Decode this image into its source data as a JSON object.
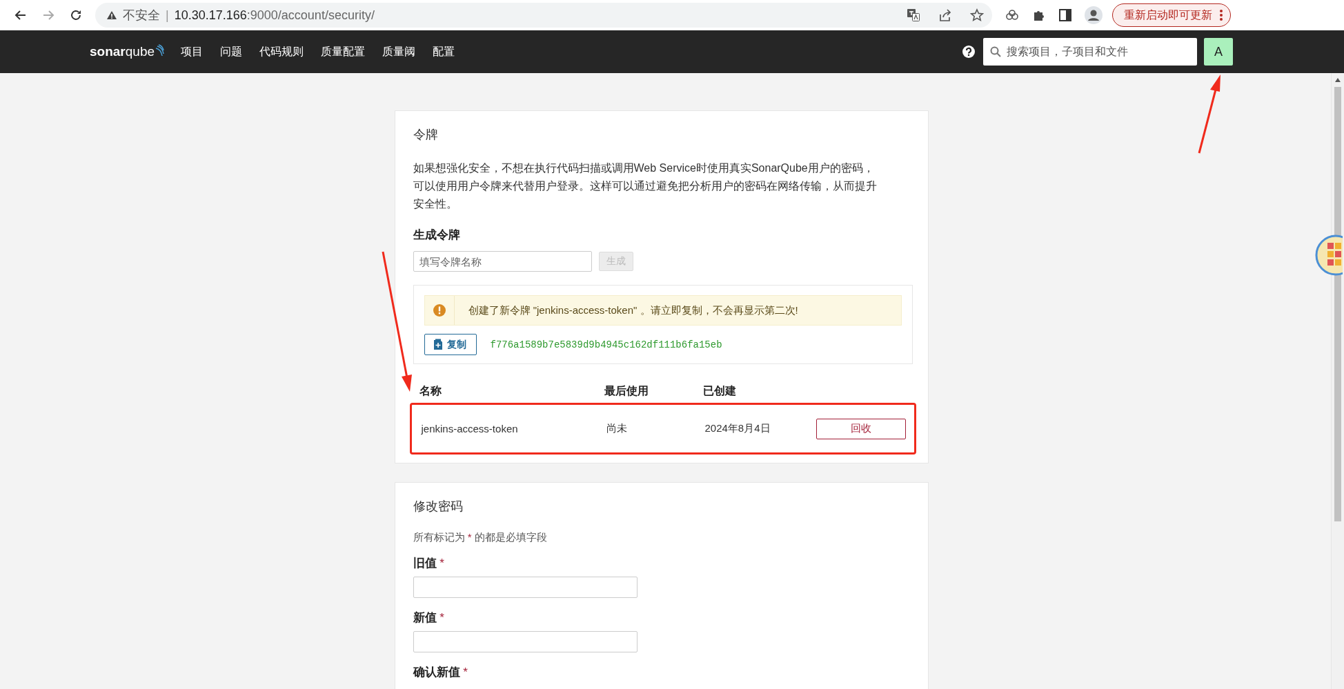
{
  "browser": {
    "back_enabled": true,
    "forward_enabled": false,
    "security_label": "不安全",
    "separator": "|",
    "host": "10.30.17.166",
    "path": ":9000/account/security/",
    "update_button": "重新启动即可更新"
  },
  "navbar": {
    "logo": "**sonar**qube",
    "items": [
      "项目",
      "问题",
      "代码规则",
      "质量配置",
      "质量阈",
      "配置"
    ],
    "search": {
      "placeholder": "搜索项目，子项目和文件"
    },
    "avatar": "A"
  },
  "token_card": {
    "title": "令牌",
    "description": "如果想强化安全，不想在执行代码扫描或调用Web Service时使用真实SonarQube用户的密码，可以使用用户令牌来代替用户登录。这样可以通过避免把分析用户的密码在网络传输，从而提升安全性。",
    "generate_heading": "生成令牌",
    "name_field": {
      "placeholder": "填写令牌名称"
    },
    "generate_button": {
      "label": "生成",
      "disabled": true
    },
    "alert": {
      "kind": "warning",
      "message": "创建了新令牌 \"jenkins-access-token\" 。请立即复制，不会再显示第二次!"
    },
    "copy_button": "复制",
    "token": "f776a1589b7e5839d9b4945c162df111b6fa15eb",
    "table": {
      "columns": [
        "名称",
        "最后使用",
        "已创建"
      ],
      "rows": [
        {
          "name": "jenkins-access-token",
          "last_used": "尚未",
          "created": "2024年8月4日",
          "action": "回收",
          "highlighted": true
        }
      ]
    }
  },
  "password_card": {
    "title": "修改密码",
    "required_note": [
      {
        "kind": "text",
        "text": "所有标记为 "
      },
      {
        "kind": "mark",
        "text": "*"
      },
      {
        "kind": "text",
        "text": " 的都是必填字段"
      }
    ],
    "fields": [
      {
        "label": "旧值",
        "required_mark": "*",
        "kind": "input"
      },
      {
        "label": "新值",
        "required_mark": "*",
        "kind": "input"
      },
      {
        "label": "确认新值",
        "required_mark": "*",
        "kind": "label"
      }
    ]
  }
}
